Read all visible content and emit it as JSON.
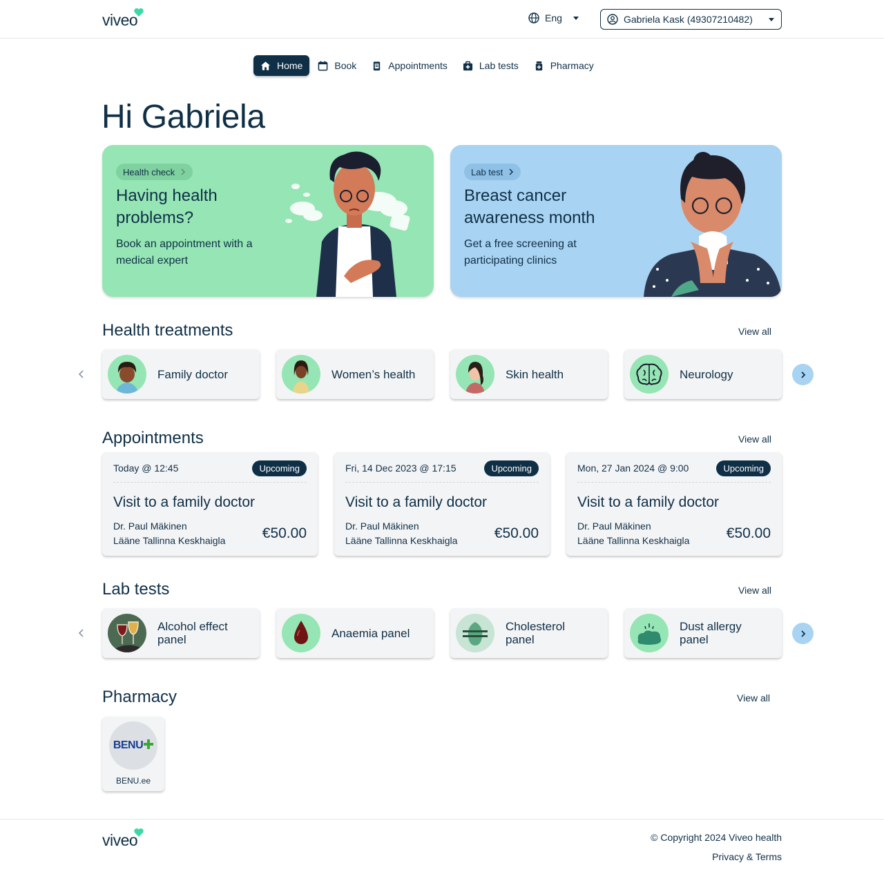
{
  "header": {
    "logo": "viveo",
    "language": "Eng",
    "user": "Gabriela Kask (49307210482)"
  },
  "nav": [
    {
      "label": "Home",
      "icon": "home-icon",
      "active": true
    },
    {
      "label": "Book",
      "icon": "calendar-icon",
      "active": false
    },
    {
      "label": "Appointments",
      "icon": "clipboard-icon",
      "active": false
    },
    {
      "label": "Lab tests",
      "icon": "medkit-icon",
      "active": false
    },
    {
      "label": "Pharmacy",
      "icon": "pill-bottle-icon",
      "active": false
    }
  ],
  "greeting": "Hi Gabriela",
  "promos": [
    {
      "chip": "Health check",
      "title": "Having health problems?",
      "text": "Book an appointment with a medical expert",
      "bg": "#95e6b4"
    },
    {
      "chip": "Lab test",
      "title": "Breast cancer awareness month",
      "text": "Get a free screening at participating clinics",
      "bg": "#a9d3f2"
    }
  ],
  "treatments": {
    "title": "Health treatments",
    "view_all": "View all",
    "items": [
      {
        "label": "Family doctor"
      },
      {
        "label": "Women’s health"
      },
      {
        "label": "Skin health"
      },
      {
        "label": "Neurology"
      }
    ]
  },
  "appointments": {
    "title": "Appointments",
    "view_all": "View all",
    "items": [
      {
        "when": "Today @ 12:45",
        "status": "Upcoming",
        "title": "Visit to a family doctor",
        "doctor": "Dr. Paul Mäkinen",
        "clinic": "Lääne Tallinna Keskhaigla",
        "price": "€50.00"
      },
      {
        "when": "Fri, 14 Dec 2023 @ 17:15",
        "status": "Upcoming",
        "title": "Visit to a family doctor",
        "doctor": "Dr. Paul Mäkinen",
        "clinic": "Lääne Tallinna Keskhaigla",
        "price": "€50.00"
      },
      {
        "when": "Mon, 27 Jan 2024 @ 9:00",
        "status": "Upcoming",
        "title": "Visit to a family doctor",
        "doctor": "Dr. Paul Mäkinen",
        "clinic": "Lääne Tallinna Keskhaigla",
        "price": "€50.00"
      }
    ]
  },
  "lab_tests": {
    "title": "Lab tests",
    "view_all": "View all",
    "items": [
      {
        "label": "Alcohol effect panel"
      },
      {
        "label": "Anaemia panel"
      },
      {
        "label": "Cholesterol panel"
      },
      {
        "label": "Dust allergy panel"
      }
    ]
  },
  "pharmacy": {
    "title": "Pharmacy",
    "view_all": "View all",
    "items": [
      {
        "logo_text": "BENU",
        "label": "BENU.ee"
      }
    ]
  },
  "footer": {
    "logo": "viveo",
    "copyright": "© Copyright 2024 Viveo health",
    "terms": "Privacy & Terms"
  },
  "colors": {
    "primary": "#0f2f47",
    "accent": "#3cd9a6",
    "green_card": "#95e6b4",
    "blue_card": "#a9d3f2"
  }
}
